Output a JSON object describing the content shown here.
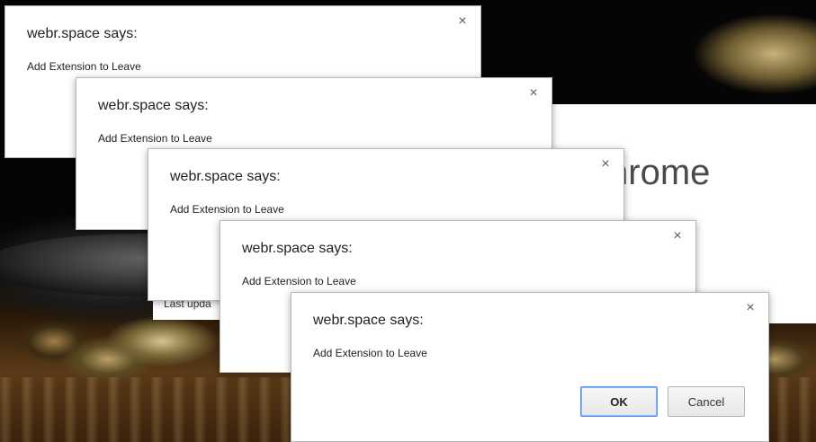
{
  "page": {
    "heading_fragment": "hrome",
    "last_updated_fragment": "Last upda"
  },
  "dialogs": [
    {
      "title": "webr.space says:",
      "message": "Add Extension to Leave",
      "close_glyph": "×"
    },
    {
      "title": "webr.space says:",
      "message": "Add Extension to Leave",
      "close_glyph": "×"
    },
    {
      "title": "webr.space says:",
      "message": "Add Extension to Leave",
      "close_glyph": "×"
    },
    {
      "title": "webr.space says:",
      "message": "Add Extension to Leave",
      "close_glyph": "×"
    },
    {
      "title": "webr.space says:",
      "message": "Add Extension to Leave",
      "close_glyph": "×",
      "ok_label": "OK",
      "cancel_label": "Cancel"
    }
  ],
  "colors": {
    "dialog_background": "#ffffff",
    "ok_focus_ring": "#4d90fe"
  }
}
